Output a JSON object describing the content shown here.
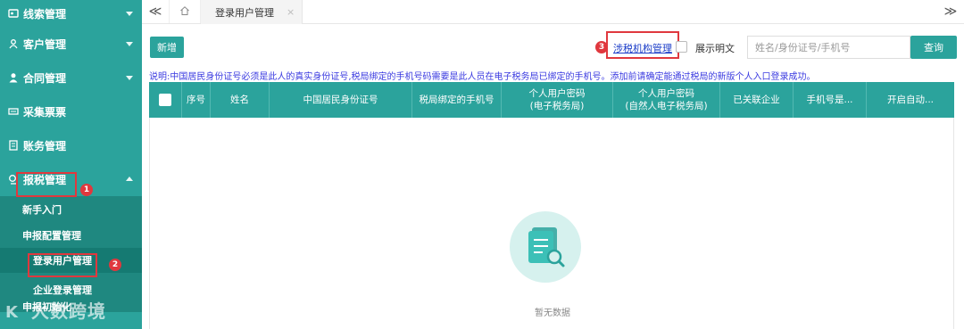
{
  "sidebar": {
    "items": [
      {
        "label": "线索管理",
        "icon": "contact-card-icon"
      },
      {
        "label": "客户管理",
        "icon": "user-group-icon"
      },
      {
        "label": "合同管理",
        "icon": "user-icon"
      },
      {
        "label": "采集票票",
        "icon": "ticket-icon"
      },
      {
        "label": "账务管理",
        "icon": "ledger-icon"
      },
      {
        "label": "报税管理",
        "icon": "tax-icon"
      }
    ],
    "sub_items": {
      "guide": "新手入门",
      "config": "申报配置管理",
      "login_users": "登录用户管理",
      "enterprise_login": "企业登录管理",
      "init": "申报初始化"
    },
    "watermark": "大数跨境"
  },
  "annotations": {
    "step1": "1",
    "step2": "2",
    "step3": "3"
  },
  "tabbar": {
    "left_arrow": "≪",
    "right_arrow": "≫",
    "active_tab": "登录用户管理",
    "close": "×"
  },
  "toolbar": {
    "add_label": "新增",
    "agency_link": "涉税机构管理",
    "show_plain_label": "展示明文",
    "search_placeholder": "姓名/身份证号/手机号",
    "search_button": "查询"
  },
  "notice": "说明:中国居民身份证号必须是此人的真实身份证号,税局绑定的手机号码需要是此人员在电子税务局已绑定的手机号。添加前请确定能通过税局的新版个人入口登录成功。",
  "table": {
    "headers": [
      {
        "line1": "序号"
      },
      {
        "line1": "姓名"
      },
      {
        "line1": "中国居民身份证号"
      },
      {
        "line1": "税局绑定的手机号"
      },
      {
        "line1": "个人用户密码",
        "line2": "(电子税务局)"
      },
      {
        "line1": "个人用户密码",
        "line2": "(自然人电子税务局)"
      },
      {
        "line1": "已关联企业"
      },
      {
        "line1": "手机号是..."
      },
      {
        "line1": "开启自动..."
      }
    ],
    "empty_text": "暂无数据"
  },
  "colors": {
    "brand": "#2ba39c",
    "annotation": "#e0383e",
    "link": "#1a3cc8"
  }
}
